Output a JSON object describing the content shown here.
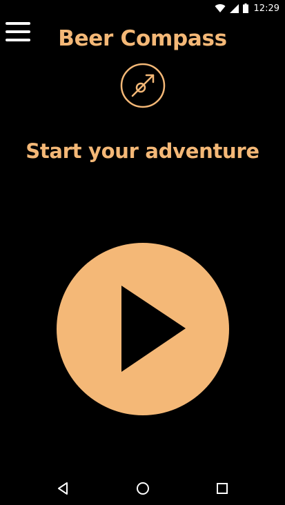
{
  "status_bar": {
    "time": "12:29",
    "icons": [
      "wifi-icon",
      "cellular-signal-icon",
      "battery-icon"
    ]
  },
  "header": {
    "menu_icon": "hamburger-menu-icon",
    "title": "Beer Compass",
    "logo_icon": "compass-arrow-icon"
  },
  "main": {
    "headline": "Start your adventure",
    "play_icon": "play-icon"
  },
  "nav_bar": {
    "buttons": [
      "back-icon",
      "home-icon",
      "recents-icon"
    ]
  },
  "colors": {
    "background": "#000000",
    "accent": "#f4b877",
    "system_icons": "#ffffff"
  }
}
